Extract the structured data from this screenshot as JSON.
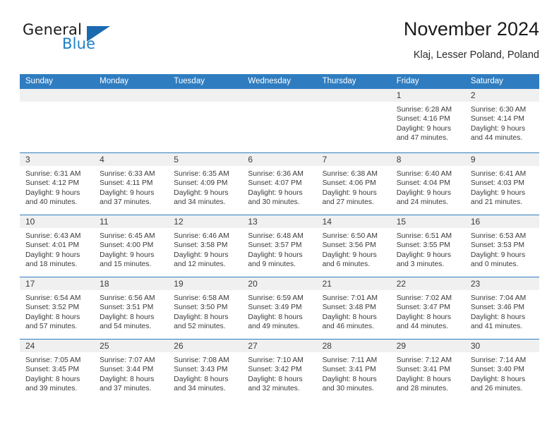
{
  "brand": {
    "word1": "General",
    "word2": "Blue",
    "triangle_color": "#1b6ab0",
    "blue_color": "#1f7fc4"
  },
  "header": {
    "title": "November 2024",
    "subtitle": "Klaj, Lesser Poland, Poland",
    "accent_color": "#2f7dc0"
  },
  "weekday_headers": [
    "Sunday",
    "Monday",
    "Tuesday",
    "Wednesday",
    "Thursday",
    "Friday",
    "Saturday"
  ],
  "weeks": [
    [
      {
        "day": "",
        "sunrise": "",
        "sunset": "",
        "daylight1": "",
        "daylight2": ""
      },
      {
        "day": "",
        "sunrise": "",
        "sunset": "",
        "daylight1": "",
        "daylight2": ""
      },
      {
        "day": "",
        "sunrise": "",
        "sunset": "",
        "daylight1": "",
        "daylight2": ""
      },
      {
        "day": "",
        "sunrise": "",
        "sunset": "",
        "daylight1": "",
        "daylight2": ""
      },
      {
        "day": "",
        "sunrise": "",
        "sunset": "",
        "daylight1": "",
        "daylight2": ""
      },
      {
        "day": "1",
        "sunrise": "Sunrise: 6:28 AM",
        "sunset": "Sunset: 4:16 PM",
        "daylight1": "Daylight: 9 hours",
        "daylight2": "and 47 minutes."
      },
      {
        "day": "2",
        "sunrise": "Sunrise: 6:30 AM",
        "sunset": "Sunset: 4:14 PM",
        "daylight1": "Daylight: 9 hours",
        "daylight2": "and 44 minutes."
      }
    ],
    [
      {
        "day": "3",
        "sunrise": "Sunrise: 6:31 AM",
        "sunset": "Sunset: 4:12 PM",
        "daylight1": "Daylight: 9 hours",
        "daylight2": "and 40 minutes."
      },
      {
        "day": "4",
        "sunrise": "Sunrise: 6:33 AM",
        "sunset": "Sunset: 4:11 PM",
        "daylight1": "Daylight: 9 hours",
        "daylight2": "and 37 minutes."
      },
      {
        "day": "5",
        "sunrise": "Sunrise: 6:35 AM",
        "sunset": "Sunset: 4:09 PM",
        "daylight1": "Daylight: 9 hours",
        "daylight2": "and 34 minutes."
      },
      {
        "day": "6",
        "sunrise": "Sunrise: 6:36 AM",
        "sunset": "Sunset: 4:07 PM",
        "daylight1": "Daylight: 9 hours",
        "daylight2": "and 30 minutes."
      },
      {
        "day": "7",
        "sunrise": "Sunrise: 6:38 AM",
        "sunset": "Sunset: 4:06 PM",
        "daylight1": "Daylight: 9 hours",
        "daylight2": "and 27 minutes."
      },
      {
        "day": "8",
        "sunrise": "Sunrise: 6:40 AM",
        "sunset": "Sunset: 4:04 PM",
        "daylight1": "Daylight: 9 hours",
        "daylight2": "and 24 minutes."
      },
      {
        "day": "9",
        "sunrise": "Sunrise: 6:41 AM",
        "sunset": "Sunset: 4:03 PM",
        "daylight1": "Daylight: 9 hours",
        "daylight2": "and 21 minutes."
      }
    ],
    [
      {
        "day": "10",
        "sunrise": "Sunrise: 6:43 AM",
        "sunset": "Sunset: 4:01 PM",
        "daylight1": "Daylight: 9 hours",
        "daylight2": "and 18 minutes."
      },
      {
        "day": "11",
        "sunrise": "Sunrise: 6:45 AM",
        "sunset": "Sunset: 4:00 PM",
        "daylight1": "Daylight: 9 hours",
        "daylight2": "and 15 minutes."
      },
      {
        "day": "12",
        "sunrise": "Sunrise: 6:46 AM",
        "sunset": "Sunset: 3:58 PM",
        "daylight1": "Daylight: 9 hours",
        "daylight2": "and 12 minutes."
      },
      {
        "day": "13",
        "sunrise": "Sunrise: 6:48 AM",
        "sunset": "Sunset: 3:57 PM",
        "daylight1": "Daylight: 9 hours",
        "daylight2": "and 9 minutes."
      },
      {
        "day": "14",
        "sunrise": "Sunrise: 6:50 AM",
        "sunset": "Sunset: 3:56 PM",
        "daylight1": "Daylight: 9 hours",
        "daylight2": "and 6 minutes."
      },
      {
        "day": "15",
        "sunrise": "Sunrise: 6:51 AM",
        "sunset": "Sunset: 3:55 PM",
        "daylight1": "Daylight: 9 hours",
        "daylight2": "and 3 minutes."
      },
      {
        "day": "16",
        "sunrise": "Sunrise: 6:53 AM",
        "sunset": "Sunset: 3:53 PM",
        "daylight1": "Daylight: 9 hours",
        "daylight2": "and 0 minutes."
      }
    ],
    [
      {
        "day": "17",
        "sunrise": "Sunrise: 6:54 AM",
        "sunset": "Sunset: 3:52 PM",
        "daylight1": "Daylight: 8 hours",
        "daylight2": "and 57 minutes."
      },
      {
        "day": "18",
        "sunrise": "Sunrise: 6:56 AM",
        "sunset": "Sunset: 3:51 PM",
        "daylight1": "Daylight: 8 hours",
        "daylight2": "and 54 minutes."
      },
      {
        "day": "19",
        "sunrise": "Sunrise: 6:58 AM",
        "sunset": "Sunset: 3:50 PM",
        "daylight1": "Daylight: 8 hours",
        "daylight2": "and 52 minutes."
      },
      {
        "day": "20",
        "sunrise": "Sunrise: 6:59 AM",
        "sunset": "Sunset: 3:49 PM",
        "daylight1": "Daylight: 8 hours",
        "daylight2": "and 49 minutes."
      },
      {
        "day": "21",
        "sunrise": "Sunrise: 7:01 AM",
        "sunset": "Sunset: 3:48 PM",
        "daylight1": "Daylight: 8 hours",
        "daylight2": "and 46 minutes."
      },
      {
        "day": "22",
        "sunrise": "Sunrise: 7:02 AM",
        "sunset": "Sunset: 3:47 PM",
        "daylight1": "Daylight: 8 hours",
        "daylight2": "and 44 minutes."
      },
      {
        "day": "23",
        "sunrise": "Sunrise: 7:04 AM",
        "sunset": "Sunset: 3:46 PM",
        "daylight1": "Daylight: 8 hours",
        "daylight2": "and 41 minutes."
      }
    ],
    [
      {
        "day": "24",
        "sunrise": "Sunrise: 7:05 AM",
        "sunset": "Sunset: 3:45 PM",
        "daylight1": "Daylight: 8 hours",
        "daylight2": "and 39 minutes."
      },
      {
        "day": "25",
        "sunrise": "Sunrise: 7:07 AM",
        "sunset": "Sunset: 3:44 PM",
        "daylight1": "Daylight: 8 hours",
        "daylight2": "and 37 minutes."
      },
      {
        "day": "26",
        "sunrise": "Sunrise: 7:08 AM",
        "sunset": "Sunset: 3:43 PM",
        "daylight1": "Daylight: 8 hours",
        "daylight2": "and 34 minutes."
      },
      {
        "day": "27",
        "sunrise": "Sunrise: 7:10 AM",
        "sunset": "Sunset: 3:42 PM",
        "daylight1": "Daylight: 8 hours",
        "daylight2": "and 32 minutes."
      },
      {
        "day": "28",
        "sunrise": "Sunrise: 7:11 AM",
        "sunset": "Sunset: 3:41 PM",
        "daylight1": "Daylight: 8 hours",
        "daylight2": "and 30 minutes."
      },
      {
        "day": "29",
        "sunrise": "Sunrise: 7:12 AM",
        "sunset": "Sunset: 3:41 PM",
        "daylight1": "Daylight: 8 hours",
        "daylight2": "and 28 minutes."
      },
      {
        "day": "30",
        "sunrise": "Sunrise: 7:14 AM",
        "sunset": "Sunset: 3:40 PM",
        "daylight1": "Daylight: 8 hours",
        "daylight2": "and 26 minutes."
      }
    ]
  ]
}
